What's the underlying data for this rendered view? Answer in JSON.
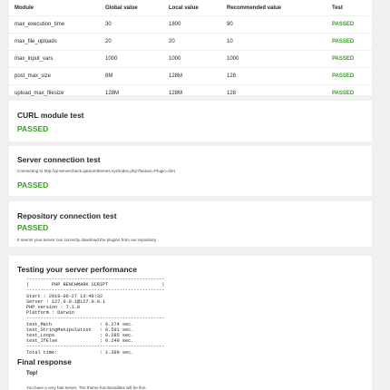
{
  "table": {
    "headers": [
      "Module",
      "Global value",
      "Local value",
      "Recommended value",
      "Test"
    ],
    "rows": [
      {
        "module": "max_execution_time",
        "global": "30",
        "local": "1800",
        "recommended": "90",
        "test": "PASSED"
      },
      {
        "module": "max_file_uploads",
        "global": "20",
        "local": "20",
        "recommended": "10",
        "test": "PASSED"
      },
      {
        "module": "max_input_vars",
        "global": "1000",
        "local": "1000",
        "recommended": "1000",
        "test": "PASSED"
      },
      {
        "module": "post_max_size",
        "global": "8M",
        "local": "128M",
        "recommended": "128",
        "test": "PASSED"
      },
      {
        "module": "upload_max_filesize",
        "global": "128M",
        "local": "128M",
        "recommended": "128",
        "test": "PASSED"
      }
    ]
  },
  "curl": {
    "title": "CURL module test",
    "status": "PASSED"
  },
  "server": {
    "title": "Server connection test",
    "message": "Connecting to http://qi-servercheck.qamumthemes.xyz/index.php?fastvar=Plugin=Get",
    "status": "PASSED"
  },
  "repo": {
    "title": "Repository connection test",
    "status": "PASSED",
    "message": "It seems your server can correctly download the plugins from our repository."
  },
  "performance": {
    "title": "Testing your server performance",
    "benchmark": "-------------------------------------------------\n|        PHP BENCHMARK SCRIPT                   |\n-------------------------------------------------\nStart : 2019-06-27 13:48:32\nServer : 127.0.0.1@127.0.0.1\nPHP version : 7.1.8\nPlatform : Darwin\n-------------------------------------------------\ntest_Math                 : 0.274 sec.\ntest_StringManipulation   : 0.591 sec.\ntest_Loops                : 0.285 sec.\ntest_IfElse               : 0.249 sec.\n-------------------------------------------------\nTotal time:               : 1.399 sec.",
    "final_title": "Final response",
    "final_top": "Top!",
    "final_message": "You have a very fast server. The theme functionalities will be fine."
  },
  "colors": {
    "passed": "#3d9a2b",
    "background": "#f0f0f1",
    "card": "#ffffff"
  }
}
